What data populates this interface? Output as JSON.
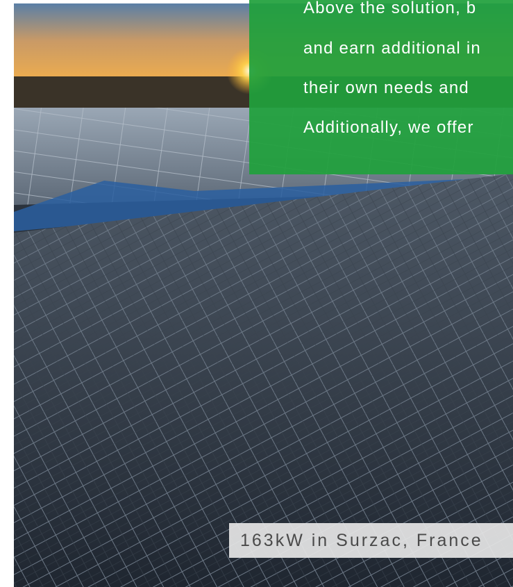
{
  "panel": {
    "lines": [
      "Above the solution, b",
      "and earn additional in",
      "their own needs and",
      "Additionally, we offer"
    ]
  },
  "caption": "163kW in Surzac, France",
  "colors": {
    "panel_green": "#20a03c",
    "caption_bg": "#e6e6e6",
    "caption_text": "#4a4a4a"
  },
  "image": {
    "description_icon": "solar-rooftop-photo"
  }
}
